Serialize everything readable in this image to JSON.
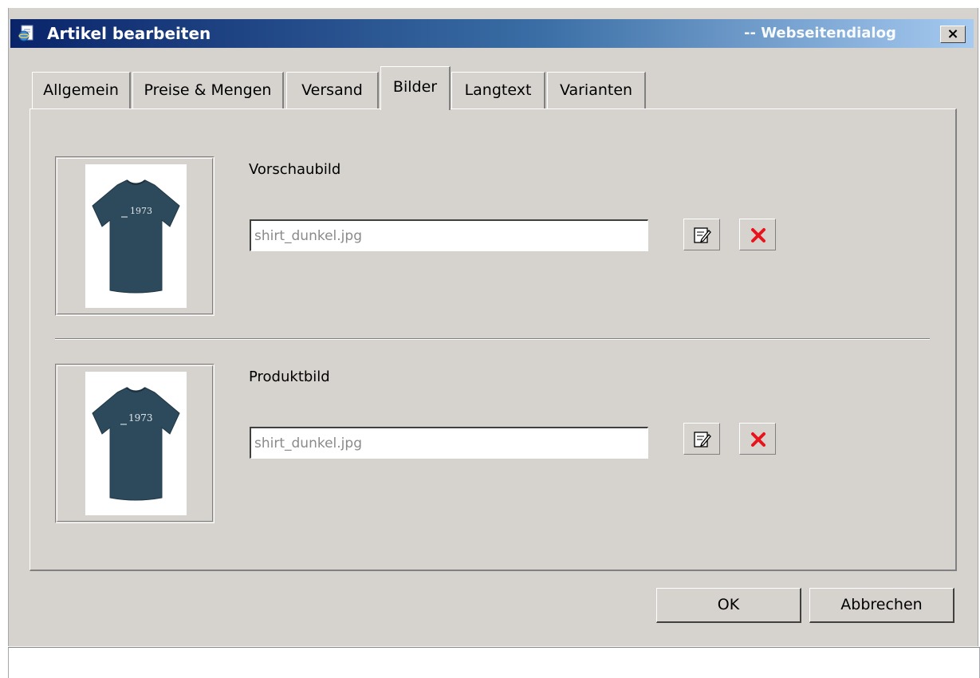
{
  "window": {
    "title": "Artikel bearbeiten",
    "title_suffix": "-- Webseitendialog",
    "close_label": "×"
  },
  "tabs": [
    {
      "label": "Allgemein",
      "active": false
    },
    {
      "label": "Preise & Mengen",
      "active": false
    },
    {
      "label": "Versand",
      "active": false
    },
    {
      "label": "Bilder",
      "active": true
    },
    {
      "label": "Langtext",
      "active": false
    },
    {
      "label": "Varianten",
      "active": false
    }
  ],
  "images": [
    {
      "label": "Vorschaubild",
      "filename": "shirt_dunkel.jpg",
      "shirt_print": "1973",
      "edit_icon": "edit-icon",
      "delete_icon": "delete-x-icon"
    },
    {
      "label": "Produktbild",
      "filename": "shirt_dunkel.jpg",
      "shirt_print": "1973",
      "edit_icon": "edit-icon",
      "delete_icon": "delete-x-icon"
    }
  ],
  "buttons": {
    "ok": "OK",
    "cancel": "Abbrechen"
  },
  "colors": {
    "dialog_bg": "#d6d3ce",
    "titlebar_start": "#0a246a",
    "titlebar_end": "#a6caf0",
    "shirt": "#2d4a5c",
    "delete_red": "#e8141b"
  }
}
